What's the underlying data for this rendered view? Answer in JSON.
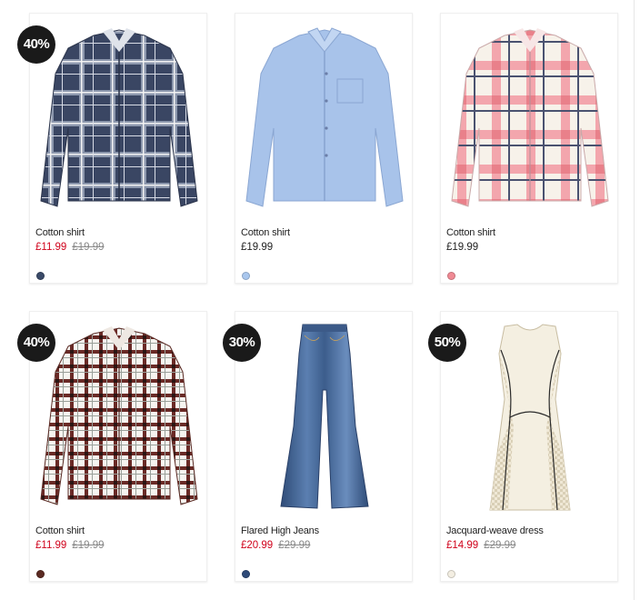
{
  "products": [
    {
      "name": "Cotton shirt",
      "badge": "40%",
      "sale_price": "£11.99",
      "original_price": "£19.99",
      "swatch": "#3a4a68"
    },
    {
      "name": "Cotton shirt",
      "price": "£19.99",
      "swatch": "#a9c7ee"
    },
    {
      "name": "Cotton shirt",
      "price": "£19.99",
      "swatch": "#f08a94"
    },
    {
      "name": "Cotton shirt",
      "badge": "40%",
      "sale_price": "£11.99",
      "original_price": "£19.99",
      "swatch": "#5b2a22"
    },
    {
      "name": "Flared High Jeans",
      "badge": "30%",
      "sale_price": "£20.99",
      "original_price": "£29.99",
      "swatch": "#2e4a78"
    },
    {
      "name": "Jacquard-weave dress",
      "badge": "50%",
      "sale_price": "£14.99",
      "original_price": "£29.99",
      "swatch": "#f3eee2"
    }
  ]
}
